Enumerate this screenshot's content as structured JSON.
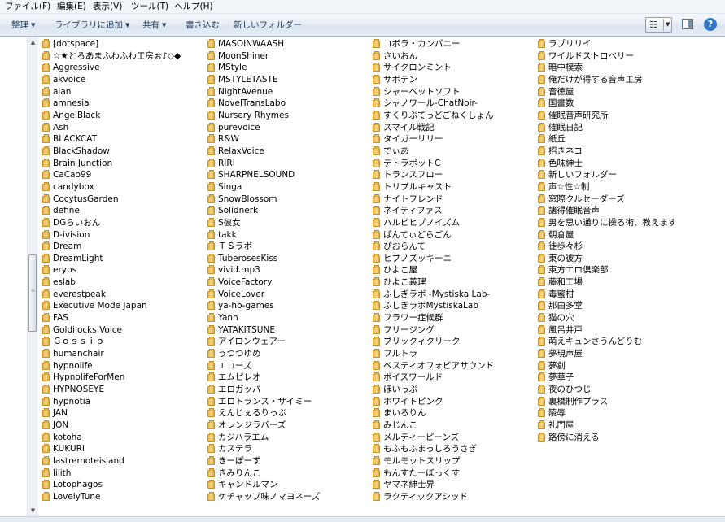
{
  "menubar": {
    "items": [
      "ファイル(F)",
      "編集(E)",
      "表示(V)",
      "ツール(T)",
      "ヘルプ(H)"
    ]
  },
  "toolbar": {
    "organize": "整理",
    "add_to_library": "ライブラリに追加",
    "share": "共有",
    "burn": "書き込む",
    "new_folder": "新しいフォルダー"
  },
  "icons": {
    "folder": "folder-icon",
    "view": "view-options-icon",
    "preview_pane": "preview-pane-icon",
    "help": "help-icon"
  },
  "colors": {
    "folder": "#f0c75e",
    "toolbar": "#dfe7f1",
    "help": "#2f77c9"
  },
  "folders": {
    "col1": [
      "[dotspace]",
      "☆★とろあまふわふわ工房ぉ♪◇◆",
      "Aggressive",
      "akvoice",
      "alan",
      "amnesia",
      "AngelBlack",
      "Ash",
      "BLACKCAT",
      "BlackShadow",
      "Brain Junction",
      "CaCao99",
      "candybox",
      "CocytusGarden",
      "define",
      "DGらいおん",
      "D-ivision",
      "Dream",
      "DreamLight",
      "eryps",
      "eslab",
      "everestpeak",
      "Executive Mode Japan",
      "FAS",
      "Goldilocks Voice",
      "Ｇｏｓｓｉｐ",
      "humanchair",
      "hypnolife",
      "HypnolifeForMen",
      "HYPNOSEYE",
      "hypnotia",
      "JAN",
      "JON",
      "kotoha",
      "KUKURI",
      "lastremoteisland",
      "lilith",
      "Lotophagos",
      "LovelyTune"
    ],
    "col2": [
      "MASOINWAASH",
      "MoonShiner",
      "MStyle",
      "MSTYLETASTE",
      "NightAvenue",
      "NovelTransLabo",
      "Nursery Rhymes",
      "purevoice",
      "R&W",
      "RelaxVoice",
      "RIRI",
      "SHARPNELSOUND",
      "Singa",
      "SnowBlossom",
      "Solidnerk",
      "S彼女",
      "takk",
      "ＴＳラボ",
      "TuberosesKiss",
      "vivid.mp3",
      "VoiceFactory",
      "VoiceLover",
      "ya-ho-games",
      "Yanh",
      "YATAKITSUNE",
      "アイロンウェアー",
      "うつつゆめ",
      "エコーズ",
      "エムピレオ",
      "エロガッパ",
      "エロトランス・サイミー",
      "えんじぇるりっぷ",
      "オレンジラバーズ",
      "カジハラエム",
      "カステラ",
      "きーぽーず",
      "きみりんこ",
      "キャンドルマン",
      "ケチャップ味ノマヨネーズ"
    ],
    "col3": [
      "コボラ・カンパニー",
      "さいおん",
      "サイクロンミント",
      "サボテン",
      "シャーベットソフト",
      "シャノワール-ChatNoir-",
      "すくりぷてっどごねくしょん",
      "スマイル戦記",
      "タイガーリリー",
      "でぃあ",
      "テトラポットC",
      "トランスフロー",
      "トリプルキャスト",
      "ナイトフレンド",
      "ネイティファス",
      "ハルピヒプノイズム",
      "ぱんてぃどらごん",
      "ぴおらんて",
      "ヒプノズッキーニ",
      "ひよこ屋",
      "ひよこ義理",
      "ふしぎラボ -Mystiska Lab-",
      "ふしぎラボMystiskaLab",
      "フラワー症候群",
      "フリージング",
      "ブリックィクリーク",
      "フルトラ",
      "ベスティオフォビアサウンド",
      "ボイスワールド",
      "ほいっぷ",
      "ホワイトピンク",
      "まいろりん",
      "みじんこ",
      "メルティーピーンズ",
      "もふもふまっしろうさぎ",
      "モルモットスリップ",
      "もんすたーぼっくす",
      "ヤマネ紳士界",
      "ラクティックアシッド"
    ],
    "col4": [
      "ラブリリイ",
      "ワイルドストロベリー",
      "暗中模索",
      "俺だけが得する音声工房",
      "音徳屋",
      "国畫数",
      "催眠音声研究所",
      "催眠日記",
      "紙丘",
      "招きネコ",
      "色味紳士",
      "新しいフォルダー",
      "声☆性☆制",
      "窓際クルセーダーズ",
      "諸得催眠音声",
      "男を思い通りに操る術、教えます",
      "朝倉屋",
      "徒歩々杉",
      "東の彼方",
      "東方エロ倶楽部",
      "藤和工場",
      "毒蜜柑",
      "那由多堂",
      "猫の穴",
      "風呂井戸",
      "萌えキュンさうんどりむ",
      "夢現声屋",
      "夢創",
      "夢華子",
      "夜のひつじ",
      "裏橋制作プラス",
      "陵辱",
      "礼門屋",
      "路傍に消える"
    ]
  }
}
